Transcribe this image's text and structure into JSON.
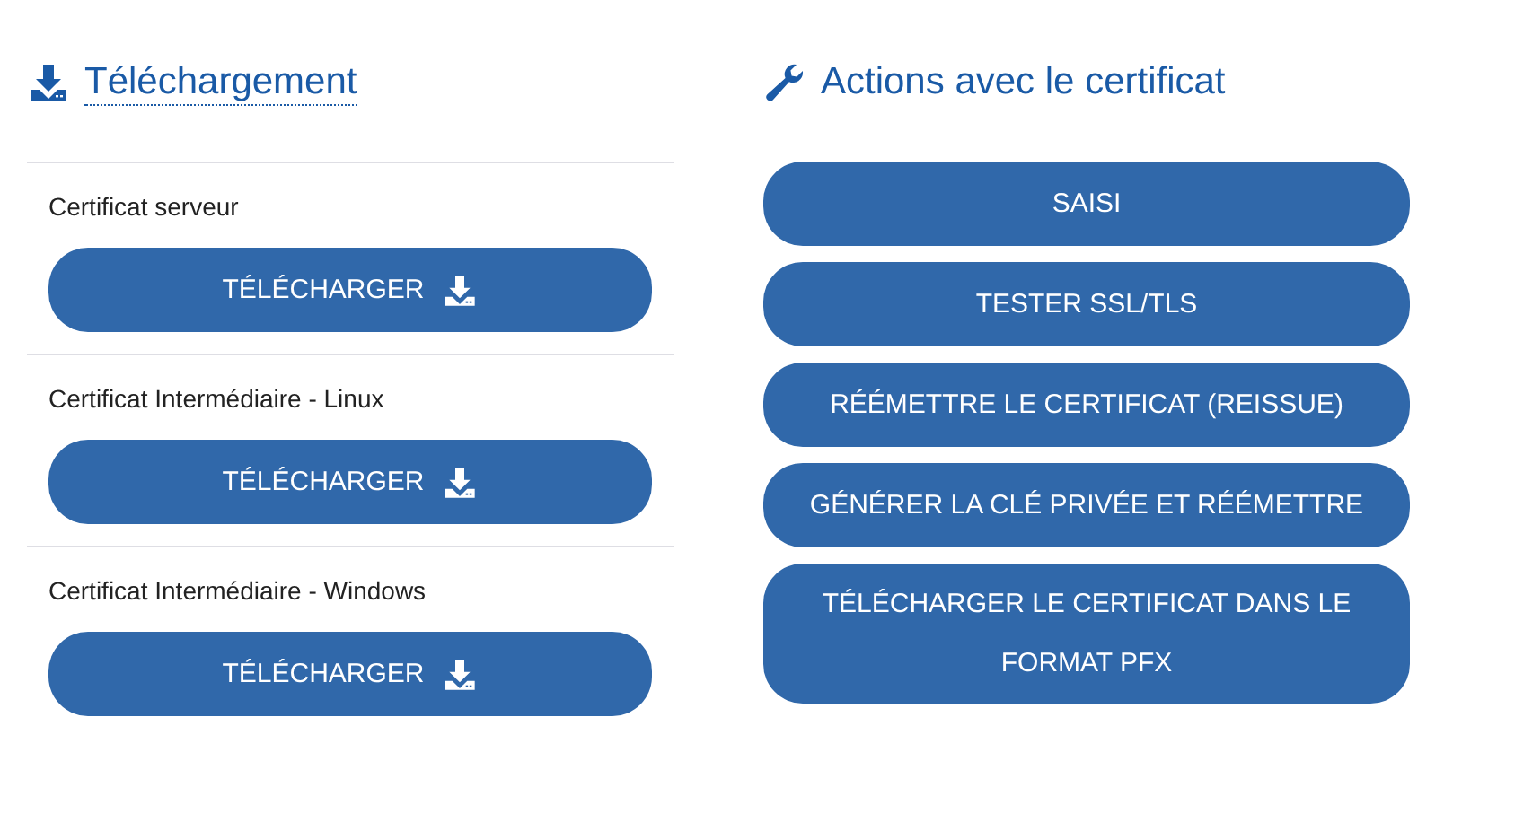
{
  "downloads": {
    "title": "Téléchargement",
    "items": [
      {
        "label": "Certificat serveur",
        "button": "TÉLÉCHARGER"
      },
      {
        "label": "Certificat Intermédiaire - Linux",
        "button": "TÉLÉCHARGER"
      },
      {
        "label": "Certificat Intermédiaire - Windows",
        "button": "TÉLÉCHARGER"
      }
    ]
  },
  "actions": {
    "title": "Actions avec le certificat",
    "buttons": [
      "SAISI",
      "TESTER SSL/TLS",
      "RÉÉMETTRE LE CERTIFICAT (REISSUE)",
      "GÉNÉRER LA CLÉ PRIVÉE ET RÉÉMETTRE",
      "TÉLÉCHARGER LE CERTIFICAT DANS LE FORMAT PFX"
    ]
  }
}
